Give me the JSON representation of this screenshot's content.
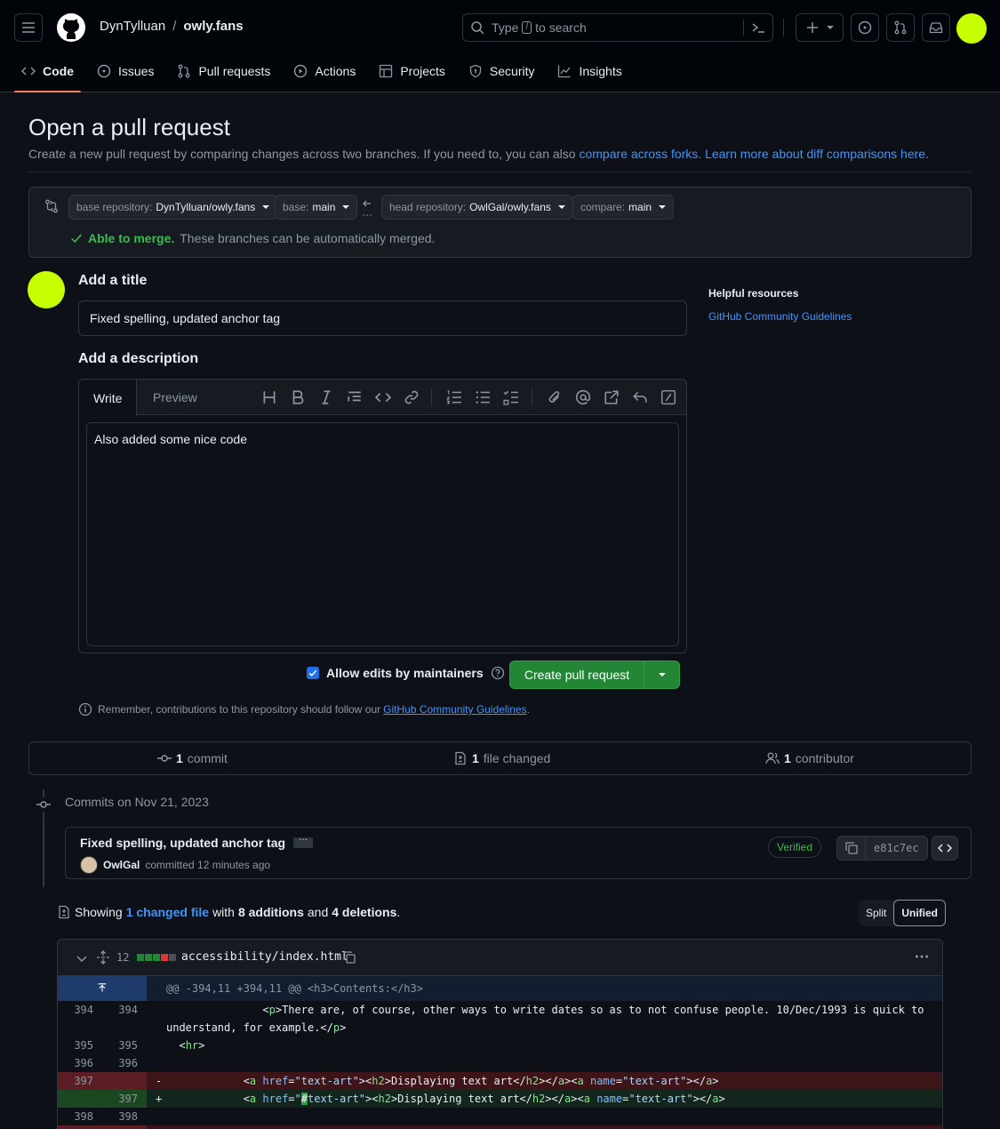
{
  "header": {
    "owner": "DynTylluan",
    "separator": "/",
    "repo": "owly.fans",
    "search_prefix": "Type",
    "search_key": "/",
    "search_suffix": "to search"
  },
  "nav_tabs": [
    {
      "label": "Code",
      "icon": "code-icon",
      "active": true
    },
    {
      "label": "Issues",
      "icon": "issue-icon"
    },
    {
      "label": "Pull requests",
      "icon": "pull-request-icon"
    },
    {
      "label": "Actions",
      "icon": "play-icon"
    },
    {
      "label": "Projects",
      "icon": "table-icon"
    },
    {
      "label": "Security",
      "icon": "shield-icon"
    },
    {
      "label": "Insights",
      "icon": "graph-icon"
    }
  ],
  "page": {
    "title": "Open a pull request",
    "subtitle_text": "Create a new pull request by comparing changes across two branches. If you need to, you can also",
    "subtitle_link1": "compare across forks.",
    "subtitle_link2": "Learn more about diff comparisons here."
  },
  "compare": {
    "base_repo_label": "base repository:",
    "base_repo_value": "DynTylluan/owly.fans",
    "base_label": "base:",
    "base_value": "main",
    "head_repo_label": "head repository:",
    "head_repo_value": "OwlGal/owly.fans",
    "compare_label": "compare:",
    "compare_value": "main",
    "merge_status": "Able to merge.",
    "merge_detail": "These branches can be automatically merged."
  },
  "form": {
    "title_label": "Add a title",
    "title_value": "Fixed spelling, updated anchor tag",
    "description_label": "Add a description",
    "tab_write": "Write",
    "tab_preview": "Preview",
    "description_value": "Also added some nice code",
    "allow_edits_label": "Allow edits by maintainers",
    "allow_edits_checked": true,
    "create_button": "Create pull request",
    "remember_text": "Remember, contributions to this repository should follow our",
    "remember_link": "GitHub Community Guidelines",
    "remember_end": "."
  },
  "sidebar": {
    "heading": "Helpful resources",
    "link": "GitHub Community Guidelines"
  },
  "stats": {
    "commits_count": "1",
    "commits_label": "commit",
    "files_count": "1",
    "files_label": "file changed",
    "contributors_count": "1",
    "contributors_label": "contributor"
  },
  "commits": {
    "date_heading": "Commits on Nov 21, 2023",
    "title": "Fixed spelling, updated anchor tag",
    "author": "OwlGal",
    "committed_text": "committed 12 minutes ago",
    "verified": "Verified",
    "sha": "e81c7ec"
  },
  "summary": {
    "showing": "Showing",
    "changed_files": "1 changed file",
    "with": "with",
    "additions": "8 additions",
    "and": "and",
    "deletions": "4 deletions",
    "period": ".",
    "split_label": "Split",
    "unified_label": "Unified"
  },
  "diff": {
    "change_count": "12",
    "file_path": "accessibility/index.html",
    "hunk_header": "@@ -394,11 +394,11 @@ <h3>Contents:</h3>",
    "lines": [
      {
        "old": "394",
        "new": "394"
      },
      {
        "old": "395",
        "new": "395"
      },
      {
        "old": "396",
        "new": "396"
      },
      {
        "old": "397",
        "new": "",
        "sign": "-"
      },
      {
        "old": "",
        "new": "397",
        "sign": "+"
      },
      {
        "old": "398",
        "new": "398"
      }
    ],
    "line394_a": "<",
    "line394_b": "p",
    "line394_c": ">There are, of course, other ways to write dates so as to not confuse people. 10/Dec/1993 is quick to",
    "line394_d": "understand, for example.</",
    "line394_e": "p",
    "line394_f": ">",
    "line395": "hr",
    "del_href": "text-art",
    "add_href_hl": "#",
    "add_href": "text-art",
    "anchor_text": "Displaying text art",
    "anchor_name": "text-art"
  },
  "colors": {
    "accent": "#4493f8",
    "success": "#238636",
    "avatar": "#c6ff00"
  }
}
